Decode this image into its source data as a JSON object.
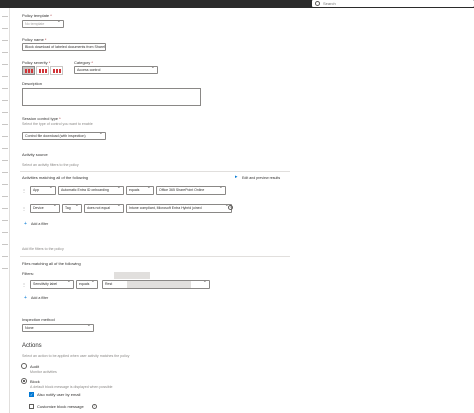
{
  "search": {
    "placeholder": "Search"
  },
  "form": {
    "policy_template": {
      "label": "Policy template",
      "required": "*",
      "value": "No template"
    },
    "policy_name": {
      "label": "Policy name",
      "required": "*",
      "value": "Block download of labeled documents from SharePoint"
    },
    "policy_severity": {
      "label": "Policy severity",
      "required": "*"
    },
    "category": {
      "label": "Category",
      "required": "*",
      "value": "Access control"
    },
    "description": {
      "label": "Description"
    },
    "session_control_type": {
      "label": "Session control type",
      "required": "*",
      "hint": "Select the type of control you want to enable",
      "value": "Control file download (with inspection)"
    },
    "activity_source": {
      "heading": "Activity source",
      "hint": "Select an activity filters to the policy",
      "match_label": "Activities matching all of the following",
      "edit_preview": "Edit and preview results",
      "row1": [
        "App",
        "Automatic Entra ID onboarding",
        "equals",
        "Office 365 SharePoint Online"
      ],
      "row2": [
        "Device",
        "Tag",
        "does not equal",
        "Intune compliant, Microsoft Entra Hybrid joined"
      ],
      "add_filter": "Add a filter"
    },
    "file_filters": {
      "hint": "Add file filters to the policy",
      "match_label": "Files matching all of the following",
      "filters_label": "Filters:",
      "row": [
        "Sensitivity label",
        "equals",
        "Rest"
      ],
      "add_filter": "Add a filter"
    },
    "inspection": {
      "label": "Inspection method",
      "value": "None"
    },
    "actions": {
      "heading": "Actions",
      "hint": "Select an action to be applied when user activity matches the policy",
      "audit": "Audit",
      "audit_desc": "Monitor activities",
      "block": "Block",
      "block_desc": "A default block message is displayed when possible",
      "notify": "Also notify user by email",
      "customize": "Customize block message"
    }
  },
  "colors": {
    "accent": "#0078d4",
    "severity": "#d13438",
    "header": "#2b2b2b"
  }
}
